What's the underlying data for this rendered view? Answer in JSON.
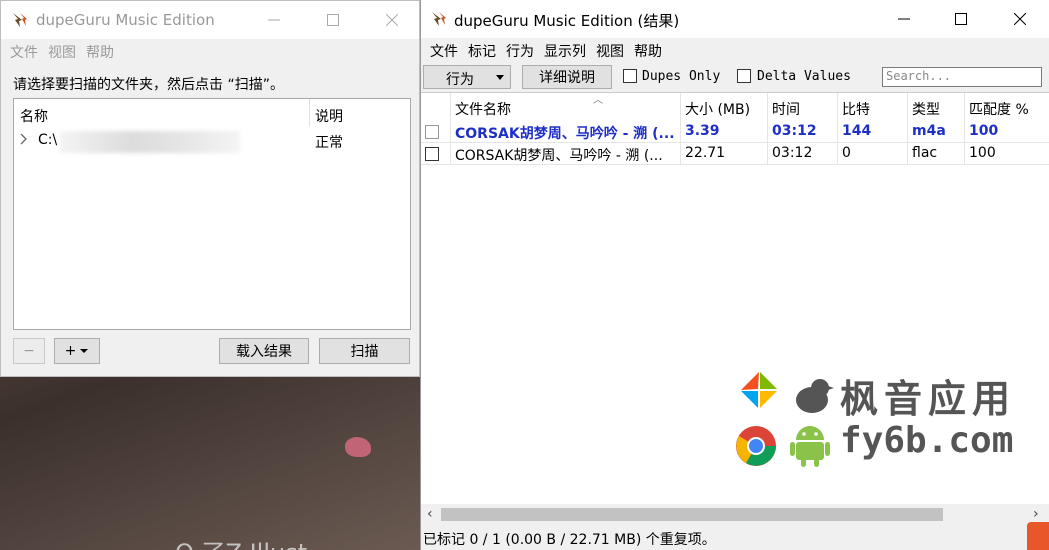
{
  "left_window": {
    "title": "dupeGuru Music Edition",
    "menu": [
      "文件",
      "视图",
      "帮助"
    ],
    "prompt": "请选择要扫描的文件夹，然后点击 “扫描”。",
    "tree": {
      "col_name": "名称",
      "col_state": "说明",
      "rows": [
        {
          "path": "C:\\",
          "state": "正常"
        }
      ]
    },
    "buttons": {
      "remove": "−",
      "add": "+",
      "load_results": "载入结果",
      "scan": "扫描"
    }
  },
  "right_window": {
    "title": "dupeGuru Music Edition (结果)",
    "menu": [
      "文件",
      "标记",
      "行为",
      "显示列",
      "视图",
      "帮助"
    ],
    "toolbar": {
      "action": "行为",
      "details": "详细说明",
      "dupes_only": "Dupes Only",
      "delta_values": "Delta Values",
      "search_placeholder": "Search..."
    },
    "columns": [
      "文件名称",
      "大小 (MB)",
      "时间",
      "比特",
      "类型",
      "匹配度 %"
    ],
    "rows": [
      {
        "name": "CORSAK胡梦周、马吟吟 - 溯 (...",
        "size": "3.39",
        "time": "03:12",
        "bitrate": "144",
        "type": "m4a",
        "match": "100",
        "is_ref": true
      },
      {
        "name": "CORSAK胡梦周、马吟吟 - 溯 (...",
        "size": "22.71",
        "time": "03:12",
        "bitrate": "0",
        "type": "flac",
        "match": "100",
        "is_ref": false
      }
    ],
    "status": "已标记 0 / 1 (0.00 B / 22.71 MB) 个重复项。"
  },
  "watermark": {
    "line1": "枫音应用",
    "line2": "fy6b.com"
  },
  "desktop_text": "O 了Z Illust",
  "colors": {
    "reference_row": "#1e2fc8",
    "watermark": "#555555"
  }
}
